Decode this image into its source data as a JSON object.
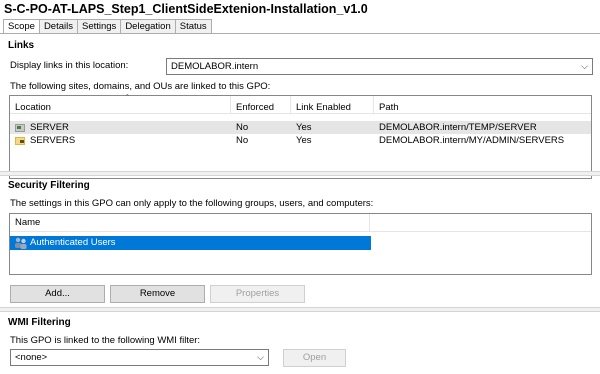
{
  "window": {
    "title": "S-C-PO-AT-LAPS_Step1_ClientSideExtenion-Installation_v1.0"
  },
  "tabs": [
    {
      "label": "Scope",
      "active": true
    },
    {
      "label": "Details",
      "active": false
    },
    {
      "label": "Settings",
      "active": false
    },
    {
      "label": "Delegation",
      "active": false
    },
    {
      "label": "Status",
      "active": false
    }
  ],
  "links": {
    "section_title": "Links",
    "display_label": "Display links in this location:",
    "location_value": "DEMOLABOR.intern",
    "description": "The following sites, domains, and OUs are linked to this GPO:",
    "columns": [
      "Location",
      "Enforced",
      "Link Enabled",
      "Path"
    ],
    "rows": [
      {
        "location": "SERVER",
        "enforced": "No",
        "link_enabled": "Yes",
        "path": "DEMOLABOR.intern/TEMP/SERVER"
      },
      {
        "location": "SERVERS",
        "enforced": "No",
        "link_enabled": "Yes",
        "path": "DEMOLABOR.intern/MY/ADMIN/SERVERS"
      }
    ]
  },
  "security_filtering": {
    "section_title": "Security Filtering",
    "description": "The settings in this GPO can only apply to the following groups, users, and computers:",
    "column": "Name",
    "rows": [
      {
        "name": "Authenticated Users"
      }
    ],
    "buttons": {
      "add": "Add...",
      "remove": "Remove",
      "properties": "Properties"
    }
  },
  "wmi_filtering": {
    "section_title": "WMI Filtering",
    "description": "This GPO is linked to the following WMI filter:",
    "filter_value": "<none>",
    "open_label": "Open"
  },
  "colors": {
    "selection": "#0078d7",
    "row_highlight": "#e5e5e5",
    "accent_ou": "#dcb64a"
  },
  "icons": {
    "dropdown": "chevron-down-icon",
    "ou": "organizational-unit-icon",
    "users": "user-group-icon"
  }
}
